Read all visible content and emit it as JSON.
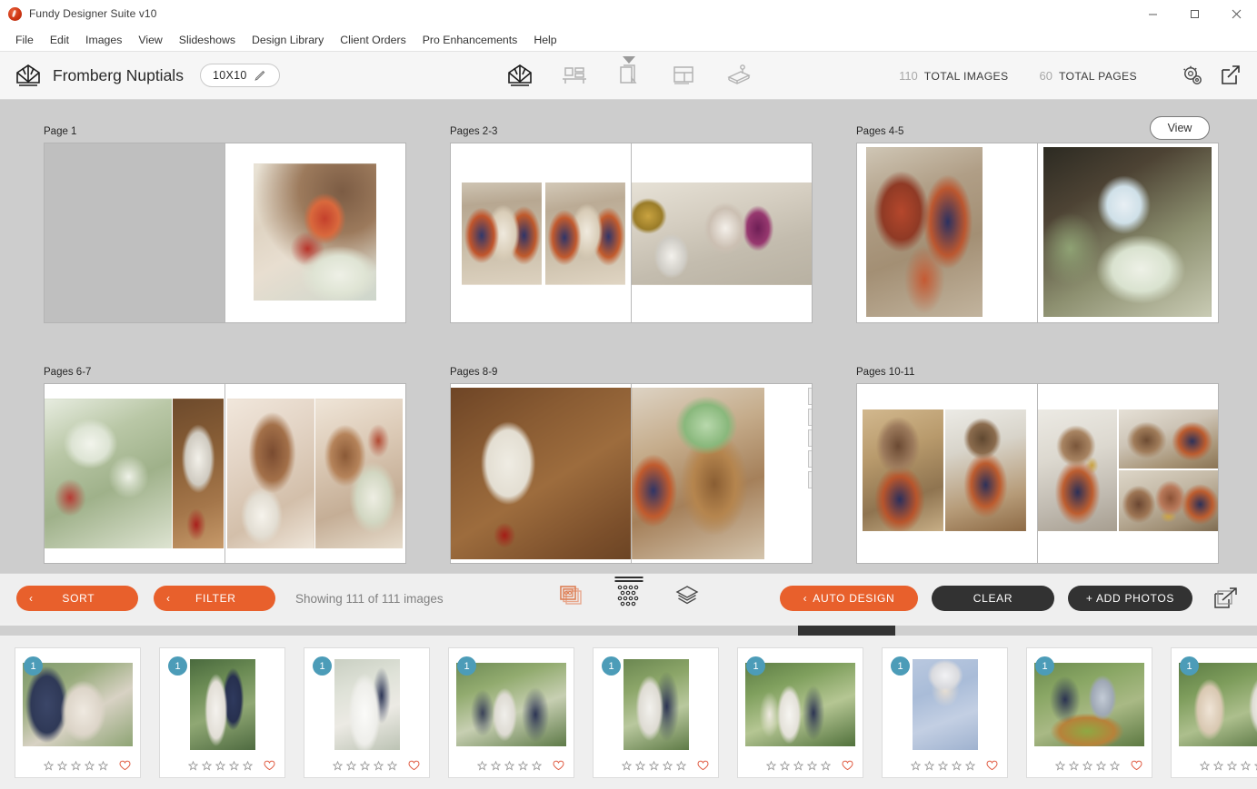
{
  "window": {
    "title": "Fundy Designer Suite v10",
    "logo_icon": "fundy-app-logo",
    "minimize_label": "—",
    "maximize_label": "□",
    "close_label": "✕"
  },
  "menubar": {
    "items": [
      {
        "label": "File"
      },
      {
        "label": "Edit"
      },
      {
        "label": "Images"
      },
      {
        "label": "View"
      },
      {
        "label": "Slideshows"
      },
      {
        "label": "Design Library"
      },
      {
        "label": "Client Orders"
      },
      {
        "label": "Pro Enhancements"
      },
      {
        "label": "Help"
      }
    ]
  },
  "toolbar": {
    "brand_icon": "fundy-book-logo-icon",
    "project_title": "Fromberg Nuptials",
    "size_value": "10X10",
    "edit_icon": "pencil-icon",
    "tools": [
      {
        "name": "album-design-tool",
        "icon": "book-open-icon",
        "active": true,
        "has_caret": false
      },
      {
        "name": "wall-design-tool",
        "icon": "wall-frames-icon",
        "active": false,
        "has_caret": false
      },
      {
        "name": "page-design-tool",
        "icon": "pages-stack-icon",
        "active": false,
        "has_caret": true
      },
      {
        "name": "layout-design-tool",
        "icon": "grid-layout-icon",
        "active": false,
        "has_caret": false
      },
      {
        "name": "stamp-design-tool",
        "icon": "stamp-icon",
        "active": false,
        "has_caret": false
      }
    ],
    "total_images_count": "110",
    "total_images_label": "TOTAL IMAGES",
    "total_pages_count": "60",
    "total_pages_label": "TOTAL PAGES",
    "settings_icon": "gear-settings-icon",
    "export_icon": "export-arrow-icon"
  },
  "canvas": {
    "view_button_label": "View",
    "spreads": [
      {
        "label": "Page 1",
        "name": "spread-page-1"
      },
      {
        "label": "Pages 2-3",
        "name": "spread-pages-2-3"
      },
      {
        "label": "Pages 4-5",
        "name": "spread-pages-4-5"
      },
      {
        "label": "Pages 6-7",
        "name": "spread-pages-6-7"
      },
      {
        "label": "Pages 8-9",
        "name": "spread-pages-8-9"
      },
      {
        "label": "Pages 10-11",
        "name": "spread-pages-10-11"
      }
    ],
    "spread_tools": [
      {
        "name": "move-spread-tool",
        "icon": "move-arrows-icon",
        "glyph": "move"
      },
      {
        "name": "rotate-spread-tool",
        "icon": "rotate-refresh-icon",
        "glyph": "rotate"
      },
      {
        "name": "swap-spread-tool",
        "icon": "shuffle-swap-icon",
        "glyph": "shuffle"
      },
      {
        "name": "layout-spread-tool",
        "icon": "grid-squares-icon",
        "glyph": "grid"
      },
      {
        "name": "delete-spread-tool",
        "icon": "close-x-icon",
        "glyph": "close"
      }
    ]
  },
  "actionbar": {
    "sort_label": "SORT",
    "sort_chevron": "‹",
    "filter_label": "FILTER",
    "filter_chevron": "‹",
    "showing_text": "Showing 111 of 111 images",
    "drag_handle_name": "panel-drag-handle",
    "center_icons": [
      {
        "name": "image-stack-view-icon",
        "icon": "stacked-photos-icon"
      },
      {
        "name": "dot-grid-view-icon",
        "icon": "dot-grid-icon"
      },
      {
        "name": "layers-view-icon",
        "icon": "layers-icon"
      }
    ],
    "auto_design_label": "AUTO DESIGN",
    "auto_design_chevron": "‹",
    "clear_label": "CLEAR",
    "add_photos_label": "+ ADD PHOTOS",
    "export_icon": "export-image-icon"
  },
  "scrollbar": {
    "name": "filmstrip-horizontal-scrollbar"
  },
  "filmstrip": {
    "star_count": 5,
    "star_icon": "star-outline-icon",
    "heart_icon": "heart-outline-icon",
    "thumbnails": [
      {
        "badge": "1",
        "name": "thumbnail-1",
        "palette": "a"
      },
      {
        "badge": "1",
        "name": "thumbnail-2",
        "palette": "b"
      },
      {
        "badge": "1",
        "name": "thumbnail-3",
        "palette": "c"
      },
      {
        "badge": "1",
        "name": "thumbnail-4",
        "palette": "d"
      },
      {
        "badge": "1",
        "name": "thumbnail-5",
        "palette": "e"
      },
      {
        "badge": "1",
        "name": "thumbnail-6",
        "palette": "f"
      },
      {
        "badge": "1",
        "name": "thumbnail-7",
        "palette": "g"
      },
      {
        "badge": "1",
        "name": "thumbnail-8",
        "palette": "h"
      },
      {
        "badge": "1",
        "name": "thumbnail-9",
        "palette": "i"
      }
    ]
  },
  "colors": {
    "accent_orange": "#e8602c",
    "dark_button": "#323232",
    "badge_teal": "#4c9cb8",
    "canvas_gray": "#cdcdcd",
    "heart_red": "#e05b42"
  }
}
